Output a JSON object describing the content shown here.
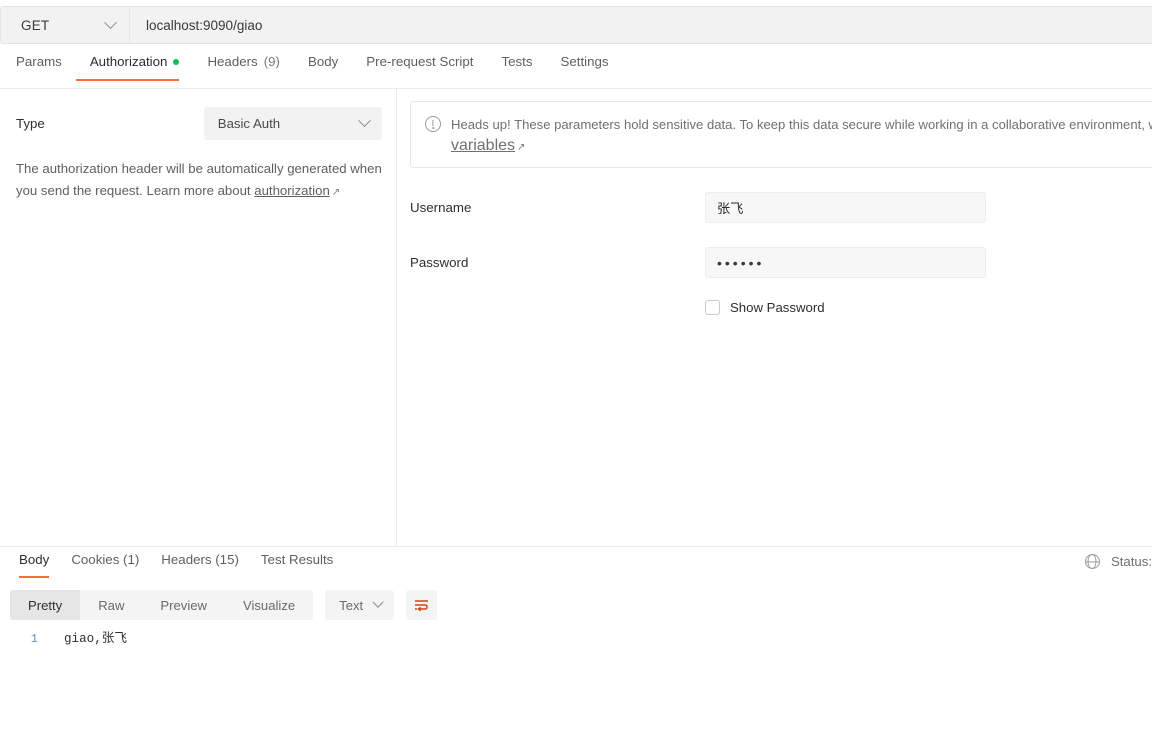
{
  "request": {
    "method": "GET",
    "url": "localhost:9090/giao",
    "tabs": [
      {
        "label": "Params",
        "count": "",
        "dot": false,
        "active": false
      },
      {
        "label": "Authorization",
        "count": "",
        "dot": true,
        "active": true
      },
      {
        "label": "Headers",
        "count": "(9)",
        "dot": false,
        "active": false
      },
      {
        "label": "Body",
        "count": "",
        "dot": false,
        "active": false
      },
      {
        "label": "Pre-request Script",
        "count": "",
        "dot": false,
        "active": false
      },
      {
        "label": "Tests",
        "count": "",
        "dot": false,
        "active": false
      },
      {
        "label": "Settings",
        "count": "",
        "dot": false,
        "active": false
      }
    ]
  },
  "auth": {
    "type_label": "Type",
    "type_value": "Basic Auth",
    "helper_prefix": "The authorization header will be automatically generated when you send the request. Learn more about ",
    "helper_link": "authorization",
    "helper_arrow": "↗",
    "banner_line1": "Heads up! These parameters hold sensitive data. To keep this data secure while working in a collaborative environment, we rec",
    "banner_link": "variables",
    "banner_arrow": "↗",
    "username_label": "Username",
    "username_value": "张飞",
    "password_label": "Password",
    "password_value": "••••••",
    "show_password_label": "Show Password"
  },
  "response": {
    "tabs": [
      {
        "label": "Body",
        "active": true
      },
      {
        "label": "Cookies (1)",
        "active": false
      },
      {
        "label": "Headers (15)",
        "active": false
      },
      {
        "label": "Test Results",
        "active": false
      }
    ],
    "status_text": "Status:",
    "views": [
      {
        "label": "Pretty",
        "active": true
      },
      {
        "label": "Raw",
        "active": false
      },
      {
        "label": "Preview",
        "active": false
      },
      {
        "label": "Visualize",
        "active": false
      }
    ],
    "format": "Text",
    "line_number": "1",
    "body_text": "giao,张飞"
  },
  "colors": {
    "accent": "#ff6c37",
    "dot_green": "#0cbb52",
    "field_bg": "#f7f7f7",
    "toolbar_bg": "#f4f4f4"
  }
}
